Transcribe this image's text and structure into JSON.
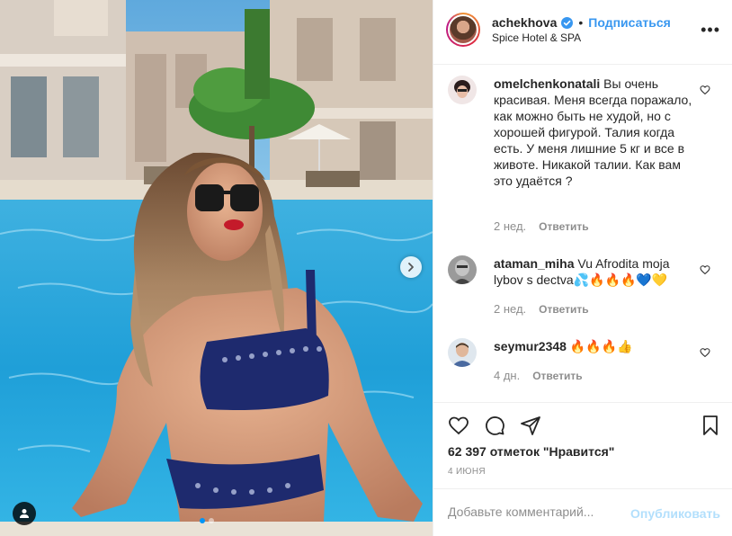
{
  "post": {
    "photo_alt": "",
    "carousel": {
      "total": 2,
      "current": 1
    }
  },
  "header": {
    "username": "achekhova",
    "separator": "•",
    "follow_label": "Подписаться",
    "location": "Spice Hotel & SPA",
    "more_label": "•••"
  },
  "comments": [
    {
      "username": "omelchenkonatali",
      "text": "Вы очень красивая. Меня всегда поражало, как можно быть не худой, но с хорошей фигурой. Талия когда есть. У меня лишние 5 кг и все в животе. Никакой талии. Как вам это удаётся ?",
      "time": "2 нед.",
      "reply_label": "Ответить"
    },
    {
      "username": "ataman_miha",
      "text": "Vu Afrodita moja lybov s dectva💦🔥🔥🔥💙💛",
      "time": "2 нед.",
      "reply_label": "Ответить"
    },
    {
      "username": "seymur2348",
      "text": "🔥🔥🔥👍",
      "time": "4 дн.",
      "reply_label": "Ответить"
    }
  ],
  "actions": {
    "likes_text": "62 397 отметок \"Нравится\"",
    "date": "4 ИЮНЯ"
  },
  "add_comment": {
    "placeholder": "Добавьте комментарий...",
    "post_label": "Опубликовать"
  },
  "colors": {
    "accent": "#3897f0",
    "post_disabled": "#b2dffc",
    "muted": "#8e8e8e"
  }
}
